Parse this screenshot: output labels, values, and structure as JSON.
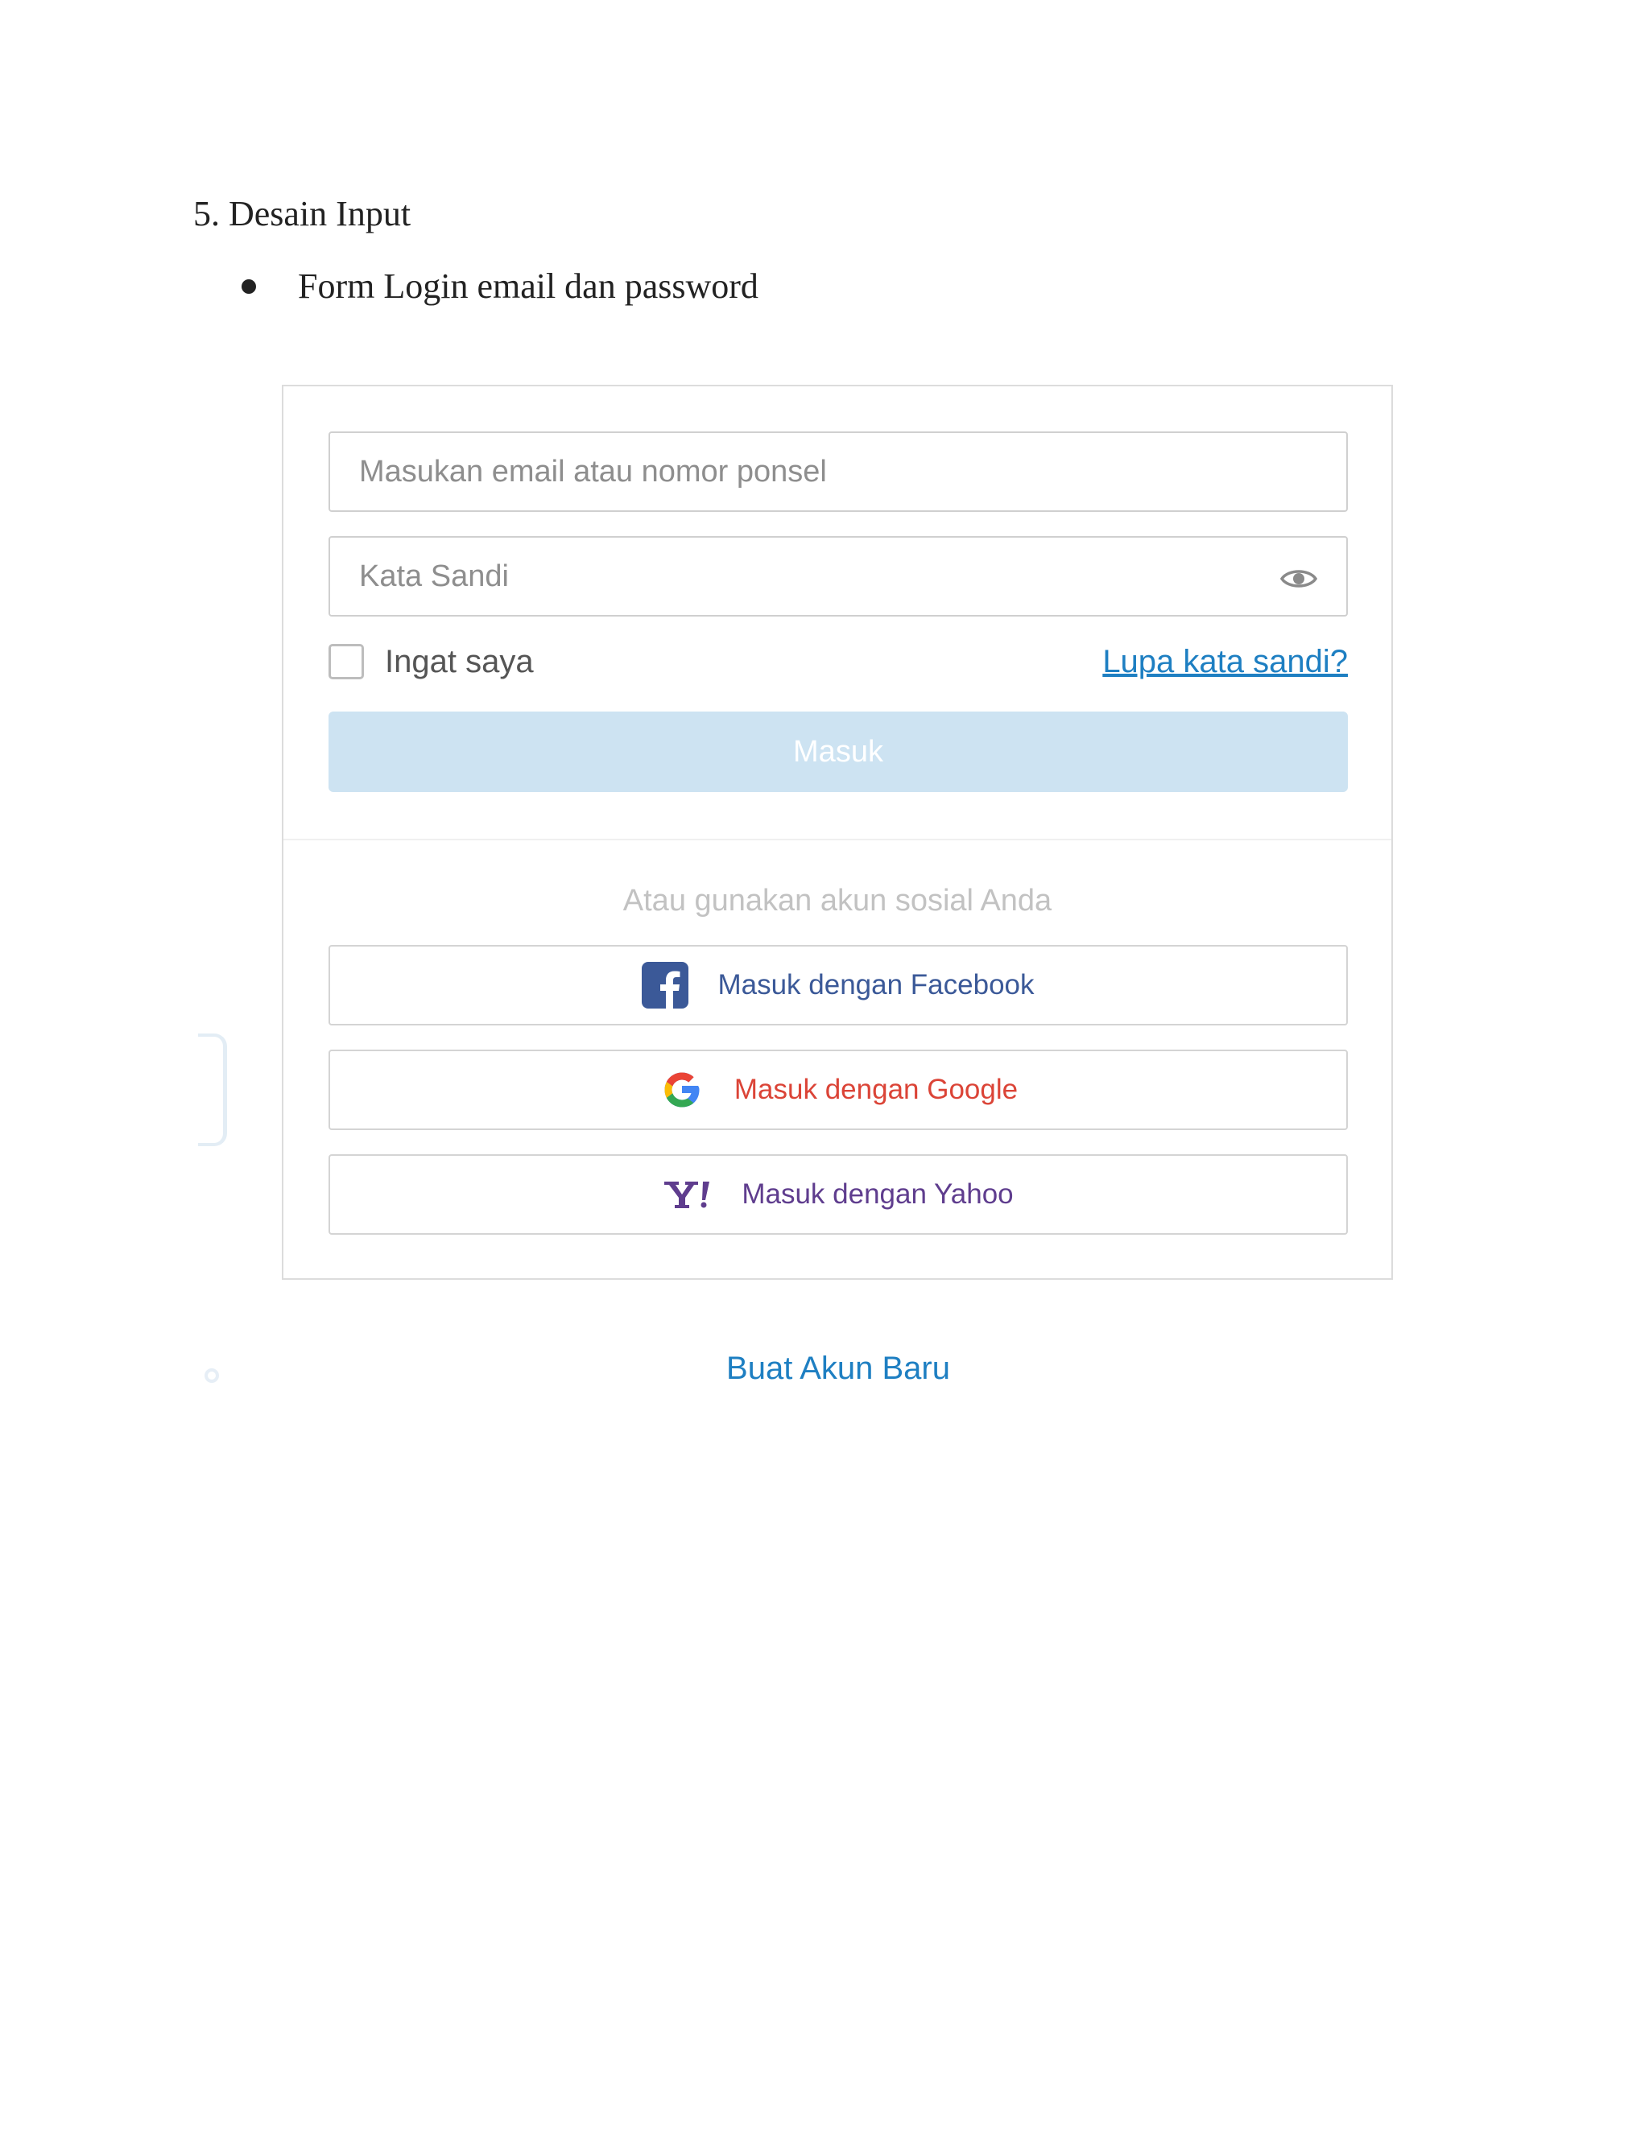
{
  "document": {
    "heading": "5. Desain Input",
    "bullet": "Form Login email dan password"
  },
  "login_form": {
    "email_placeholder": "Masukan email atau nomor ponsel",
    "password_placeholder": "Kata Sandi",
    "remember_label": "Ingat saya",
    "forgot_link": "Lupa kata sandi?",
    "submit_label": "Masuk",
    "social_caption": "Atau gunakan akun sosial Anda",
    "social": {
      "facebook_label": "Masuk dengan Facebook",
      "google_label": "Masuk dengan Google",
      "yahoo_label": "Masuk dengan Yahoo"
    },
    "create_account": "Buat Akun Baru"
  },
  "icons": {
    "password_toggle": "eye-icon",
    "facebook": "facebook-icon",
    "google": "google-icon",
    "yahoo": "yahoo-icon"
  },
  "colors": {
    "link": "#1e7fc2",
    "submit_button_bg": "#cde3f2",
    "facebook": "#3b5998",
    "google": "#db4437",
    "yahoo": "#5f3d8e"
  }
}
